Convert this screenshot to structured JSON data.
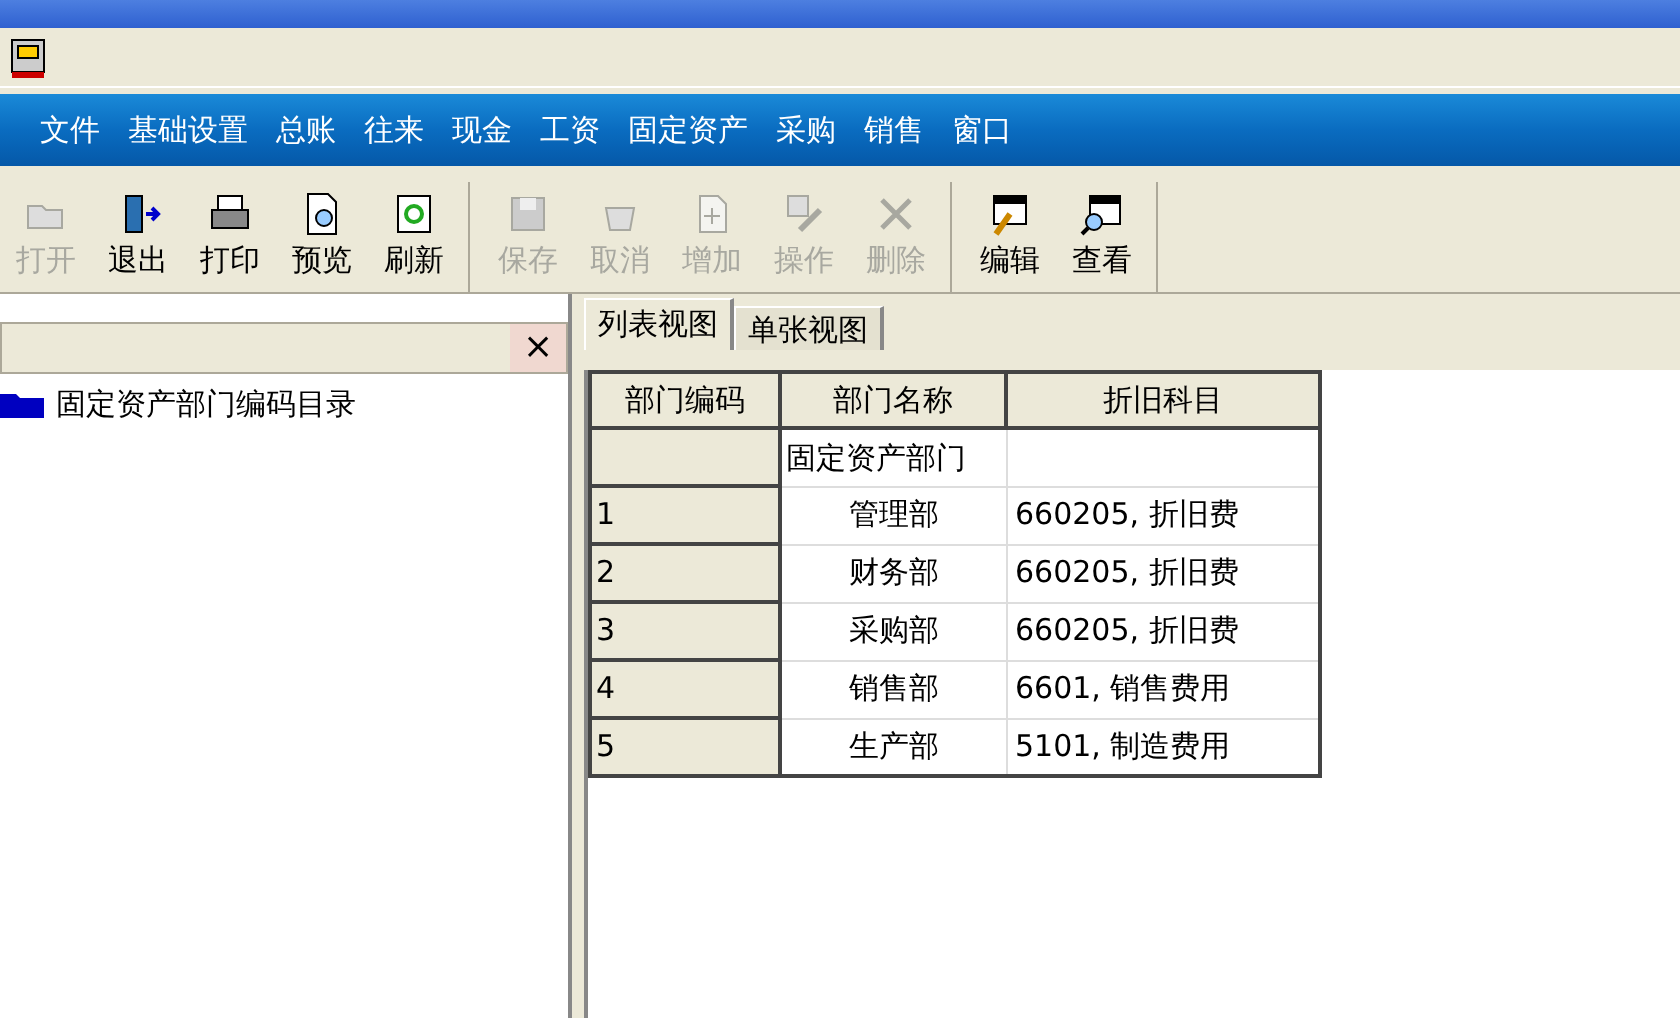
{
  "menu": [
    "文件",
    "基础设置",
    "总账",
    "往来",
    "现金",
    "工资",
    "固定资产",
    "采购",
    "销售",
    "窗口"
  ],
  "toolbar": [
    [
      {
        "label": "打开",
        "kind": "folder",
        "disabled": true
      },
      {
        "label": "退出",
        "kind": "door",
        "disabled": false
      },
      {
        "label": "打印",
        "kind": "printer",
        "disabled": false
      },
      {
        "label": "预览",
        "kind": "preview",
        "disabled": false
      },
      {
        "label": "刷新",
        "kind": "refresh",
        "disabled": false
      }
    ],
    [
      {
        "label": "保存",
        "kind": "save",
        "disabled": true
      },
      {
        "label": "取消",
        "kind": "basket",
        "disabled": true
      },
      {
        "label": "增加",
        "kind": "add",
        "disabled": true
      },
      {
        "label": "操作",
        "kind": "pen",
        "disabled": true
      },
      {
        "label": "删除",
        "kind": "x",
        "disabled": true
      }
    ],
    [
      {
        "label": "编辑",
        "kind": "edit",
        "disabled": false
      },
      {
        "label": "查看",
        "kind": "view",
        "disabled": false
      }
    ]
  ],
  "left_panel": {
    "close": "×",
    "tree": [
      {
        "label": "固定资产部门编码目录"
      }
    ]
  },
  "tabs": [
    {
      "label": "列表视图",
      "selected": true
    },
    {
      "label": "单张视图",
      "selected": false
    }
  ],
  "table": {
    "columns": [
      "部门编码",
      "部门名称",
      "折旧科目"
    ],
    "rows": [
      {
        "kind": "group",
        "code": "",
        "name": "固定资产部门",
        "account": ""
      },
      {
        "kind": "item",
        "code": "1",
        "name": "管理部",
        "account": "660205, 折旧费"
      },
      {
        "kind": "item",
        "code": "2",
        "name": "财务部",
        "account": "660205, 折旧费"
      },
      {
        "kind": "item",
        "code": "3",
        "name": "采购部",
        "account": "660205, 折旧费"
      },
      {
        "kind": "item",
        "code": "4",
        "name": "销售部",
        "account": "6601, 销售费用"
      },
      {
        "kind": "item",
        "code": "5",
        "name": "生产部",
        "account": "5101, 制造费用"
      }
    ]
  }
}
